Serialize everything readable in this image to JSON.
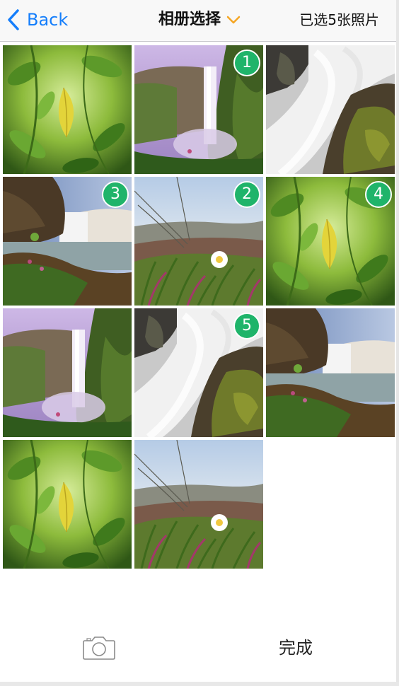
{
  "navbar": {
    "back_label": "Back",
    "title": "相册选择",
    "selected_text": "已选5张照片",
    "accent_color": "#157efb",
    "dropdown_color": "#f5a623"
  },
  "grid": {
    "badge_color": "#1fb46a",
    "photos": [
      {
        "subject": "leaf",
        "badge": ""
      },
      {
        "subject": "waterfall-valley",
        "badge": "1"
      },
      {
        "subject": "cascade",
        "badge": ""
      },
      {
        "subject": "coast-falls",
        "badge": "3"
      },
      {
        "subject": "flower-grass",
        "badge": "2"
      },
      {
        "subject": "leaf",
        "badge": "4"
      },
      {
        "subject": "waterfall-valley",
        "badge": ""
      },
      {
        "subject": "cascade",
        "badge": "5"
      },
      {
        "subject": "coast-falls",
        "badge": ""
      },
      {
        "subject": "leaf",
        "badge": ""
      },
      {
        "subject": "flower-grass",
        "badge": ""
      }
    ]
  },
  "toolbar": {
    "camera_icon": "camera-icon",
    "done_label": "完成"
  }
}
